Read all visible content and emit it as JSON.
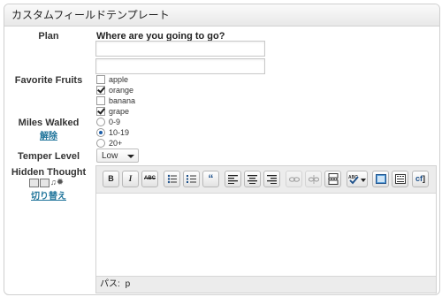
{
  "panel": {
    "title": "カスタムフィールドテンプレート"
  },
  "plan": {
    "label": "Plan",
    "question": "Where are you going to go?",
    "inputs": [
      "",
      ""
    ]
  },
  "fruits": {
    "label": "Favorite Fruits",
    "options": [
      {
        "label": "apple",
        "checked": false
      },
      {
        "label": "orange",
        "checked": true
      },
      {
        "label": "banana",
        "checked": false
      },
      {
        "label": "grape",
        "checked": true
      }
    ]
  },
  "miles": {
    "label": "Miles Walked",
    "reset_link": "解除",
    "options": [
      {
        "label": "0-9",
        "selected": false
      },
      {
        "label": "10-19",
        "selected": true
      },
      {
        "label": "20+",
        "selected": false
      }
    ]
  },
  "temper": {
    "label": "Temper Level",
    "selected": "Low"
  },
  "hidden": {
    "label": "Hidden Thought",
    "toggle_link": "切り替え",
    "editor": {
      "toolbar": [
        "bold",
        "italic",
        "strikethrough",
        "bulleted-list",
        "numbered-list",
        "blockquote",
        "align-left",
        "align-center",
        "align-right",
        "link",
        "unlink",
        "insert-more",
        "spellcheck",
        "fullscreen",
        "kitchen-sink",
        "cft"
      ],
      "status_label": "パス:",
      "status_path": "p"
    }
  }
}
